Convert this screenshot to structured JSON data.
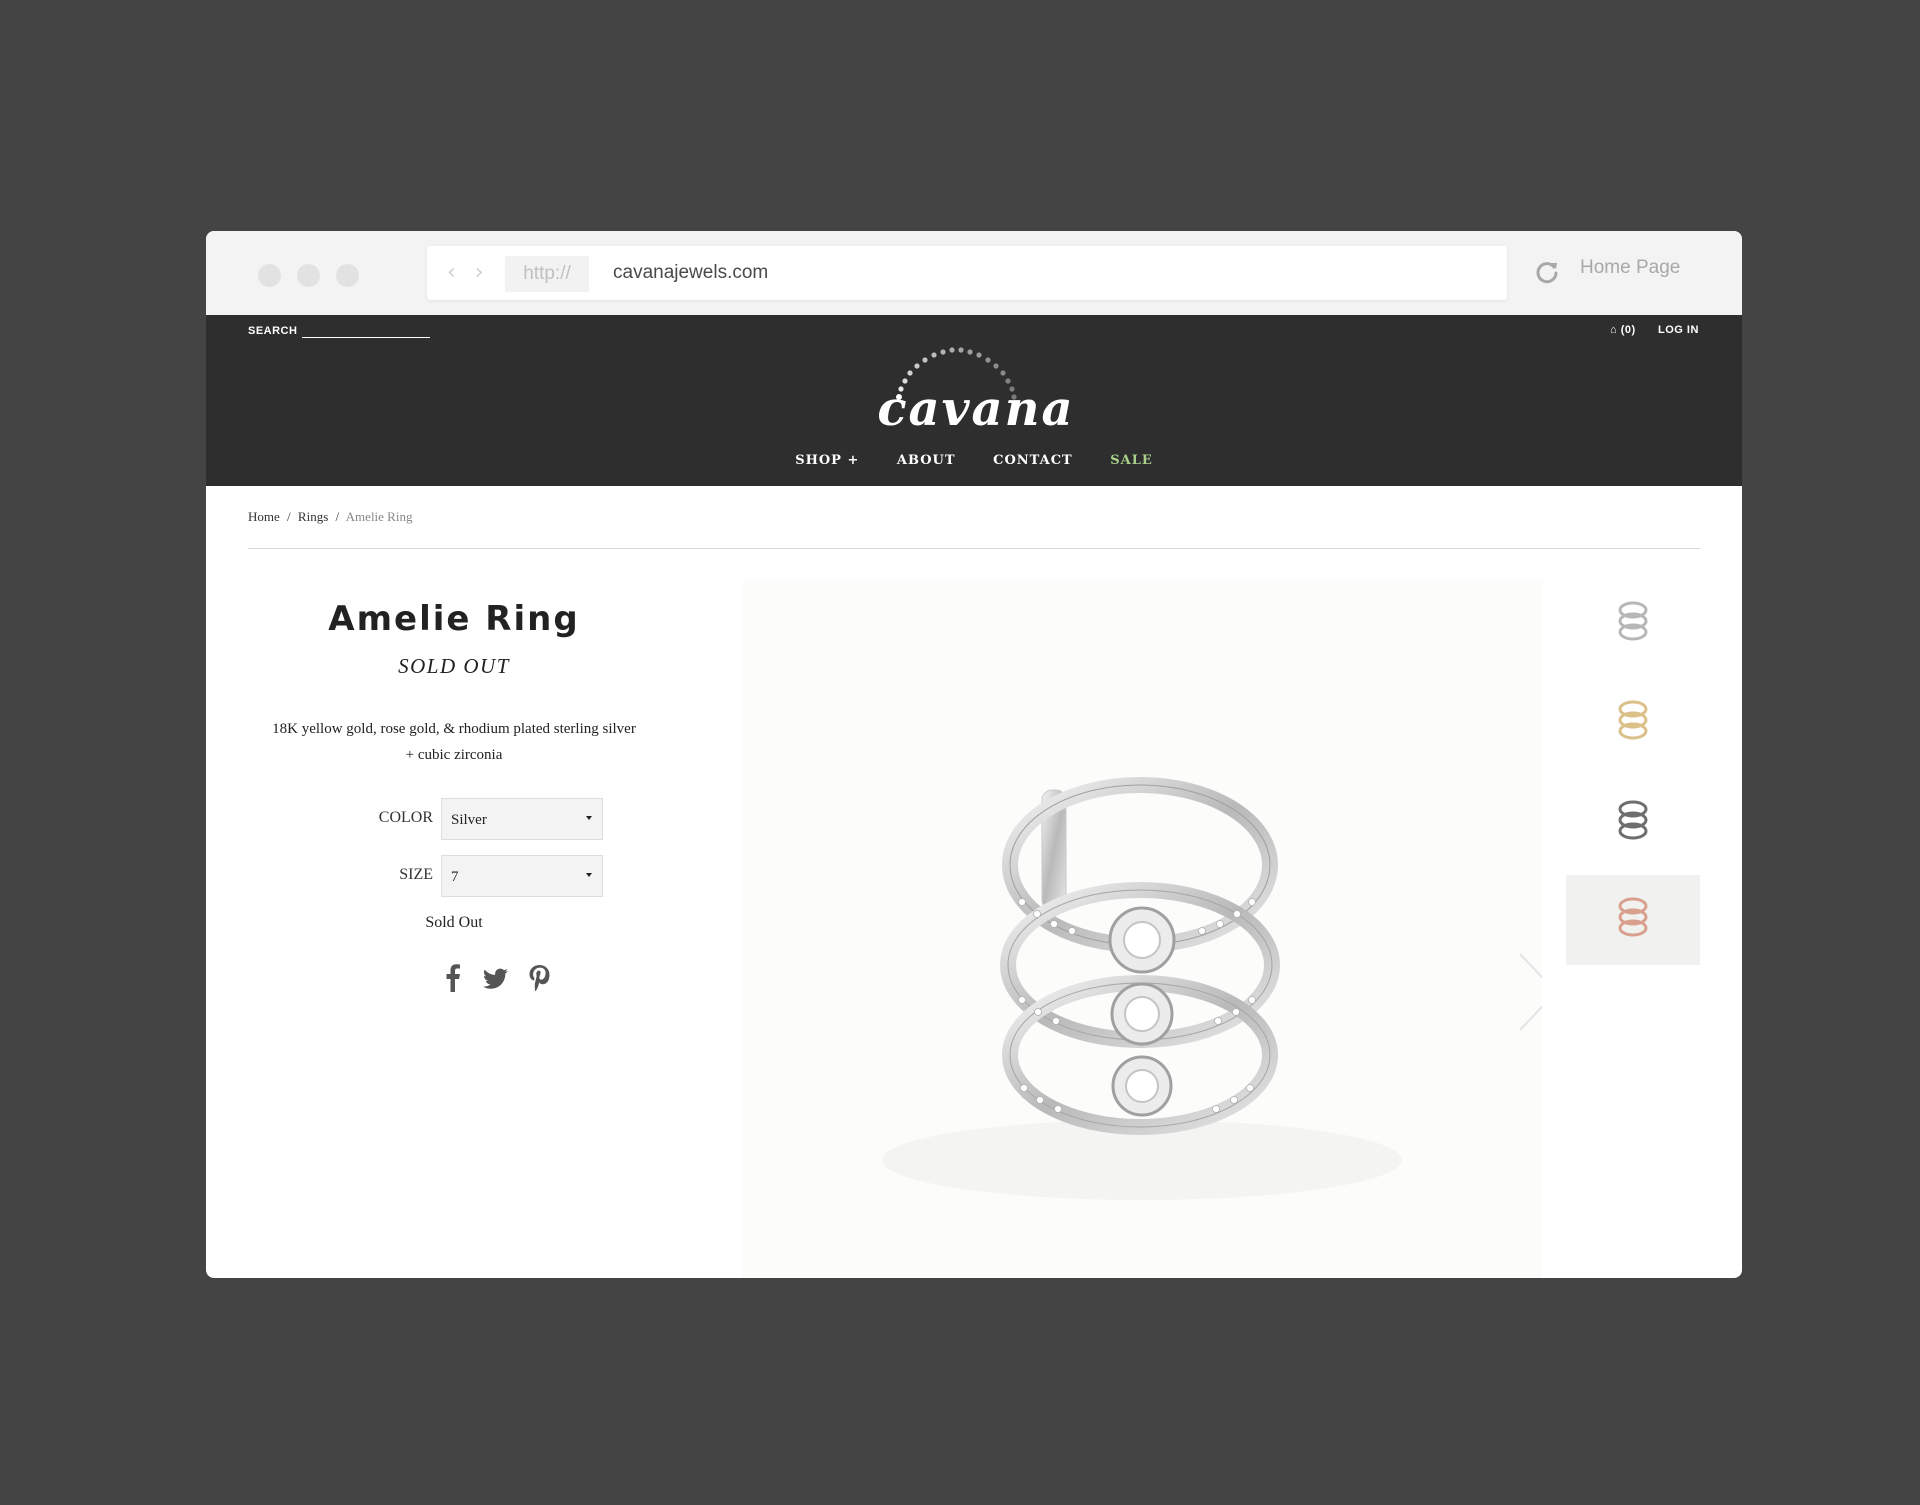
{
  "browser": {
    "protocol": "http://",
    "url": "cavanajewels.com",
    "home_label": "Home Page"
  },
  "header": {
    "search_label": "SEARCH",
    "cart_label": "(0)",
    "login_label": "LOG IN",
    "logo_text": "cavana",
    "nav": [
      "SHOP +",
      "ABOUT",
      "CONTACT",
      "SALE"
    ],
    "sale_color": "#a8d08a"
  },
  "breadcrumb": {
    "items": [
      "Home",
      "Rings",
      "Amelie Ring"
    ],
    "separator": "/"
  },
  "product": {
    "title": "Amelie Ring",
    "status": "SOLD OUT",
    "description": "18K yellow gold, rose gold, & rhodium plated sterling silver + cubic zirconia",
    "color_label": "COLOR",
    "color_value": "Silver",
    "size_label": "SIZE",
    "size_value": "7",
    "button_label": "Sold Out",
    "share_icons": [
      "facebook-icon",
      "twitter-icon",
      "pinterest-icon"
    ]
  },
  "gallery": {
    "thumbnails": [
      "silver",
      "gold",
      "black",
      "rose-gold"
    ],
    "active_thumbnail": "rose-gold",
    "next_icon": "chevron-right-icon"
  }
}
